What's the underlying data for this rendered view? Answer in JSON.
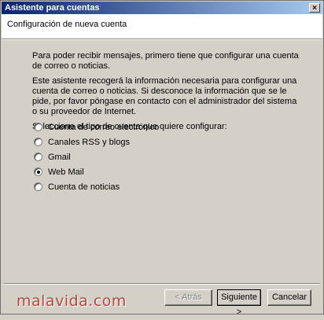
{
  "window": {
    "title": "Asistente para cuentas",
    "close_glyph": "×"
  },
  "header": {
    "title": "Configuración de nueva cuenta"
  },
  "content": {
    "paragraph1": "Para poder recibir mensajes, primero tiene que configurar una cuenta de correo o noticias.",
    "paragraph2": "Este asistente recogerá la información necesaria para configurar una cuenta de correo o noticias. Si desconoce la información que se le pide, por favor póngase en contacto con el administrador del sistema o su proveedor de Internet.",
    "prompt": "Seleccione el tipo de cuenta que quiere configurar:"
  },
  "options": [
    {
      "label": "Cuenta de correo electrónico",
      "selected": false
    },
    {
      "label": "Canales RSS y blogs",
      "selected": false
    },
    {
      "label": "Gmail",
      "selected": false
    },
    {
      "label": "Web Mail",
      "selected": true
    },
    {
      "label": "Cuenta de noticias",
      "selected": false
    }
  ],
  "buttons": {
    "back": "< Atrás",
    "next": "Siguiente >",
    "cancel": "Cancelar"
  },
  "watermark": "malavida.com",
  "colors": {
    "titlebar_start": "#0a246a",
    "titlebar_end": "#a6caf0",
    "face": "#d4d0c8",
    "watermark": "#b04a3c"
  }
}
